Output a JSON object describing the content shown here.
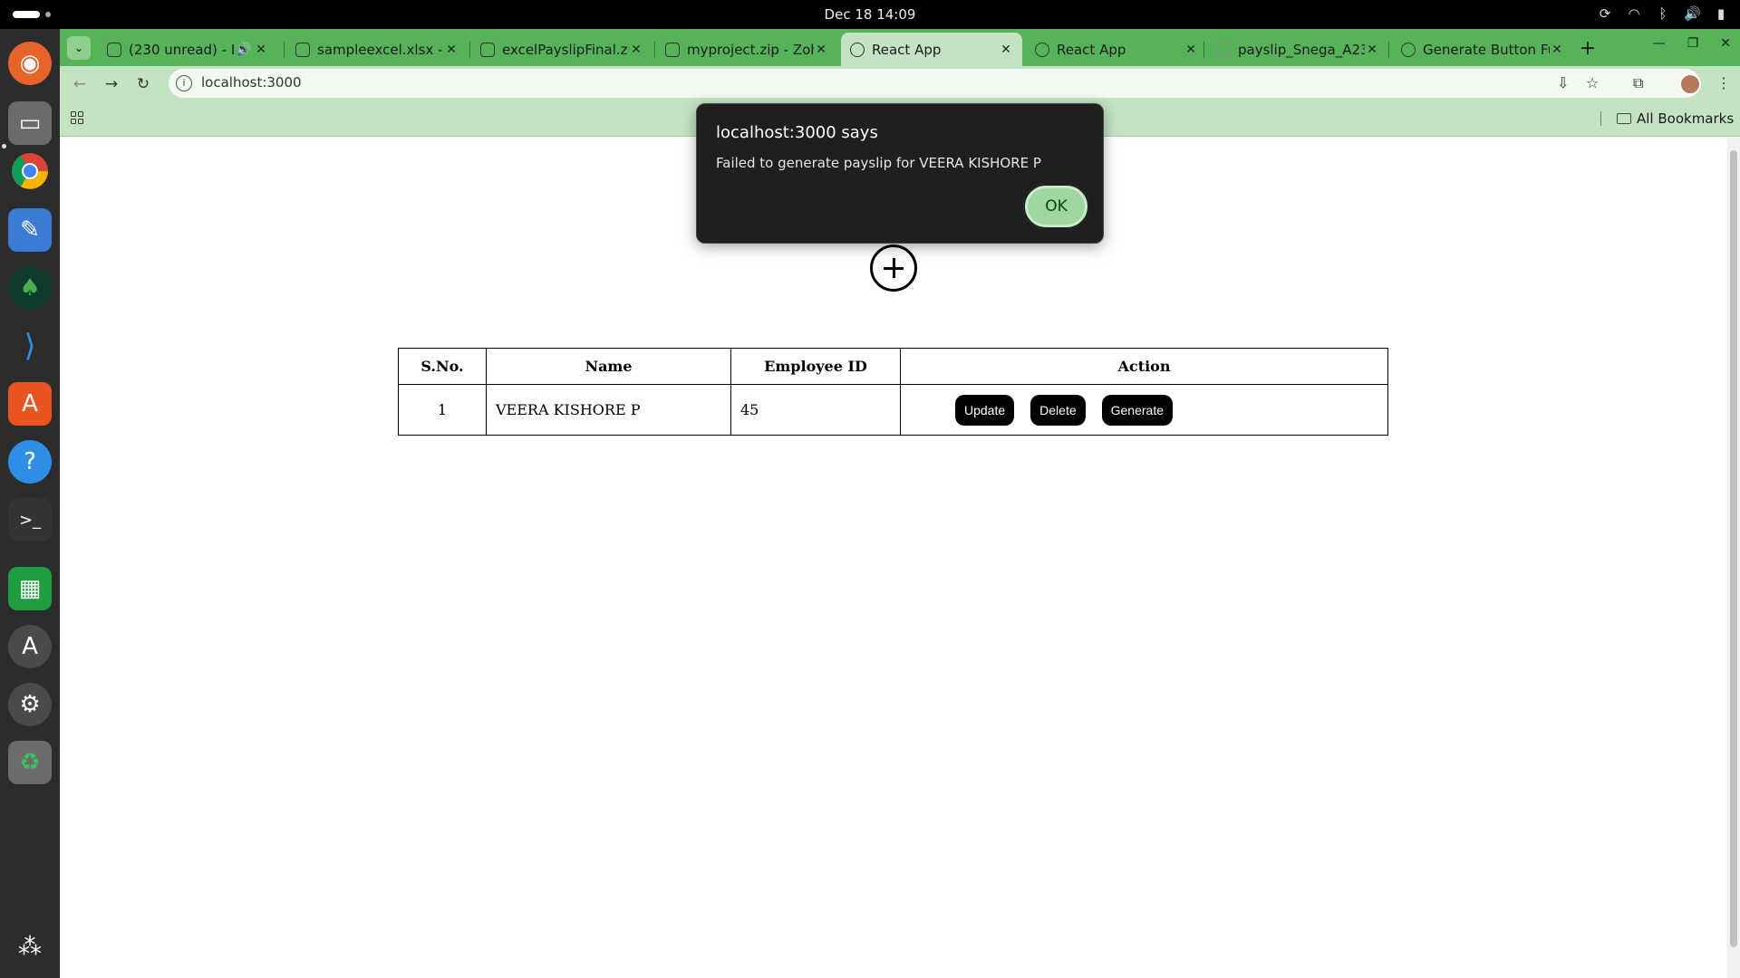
{
  "system": {
    "clock": "Dec 18  14:09"
  },
  "dock": {
    "apps": [
      "firefox-icon",
      "files-icon",
      "chrome-icon",
      "text-editor-icon",
      "mongodb-compass-icon",
      "vscode-icon",
      "app-center-icon",
      "help-icon",
      "terminal-icon",
      "spreadsheet-icon",
      "software-updater-icon",
      "settings-icon",
      "trash-icon",
      "show-apps-icon"
    ]
  },
  "browser": {
    "tabs": [
      {
        "title": "(230 unread) - In",
        "active": false
      },
      {
        "title": "sampleexcel.xlsx - Z",
        "active": false
      },
      {
        "title": "excelPayslipFinal.zip",
        "active": false
      },
      {
        "title": "myproject.zip - Zoho",
        "active": false
      },
      {
        "title": "React App",
        "active": true
      },
      {
        "title": "React App",
        "active": false
      },
      {
        "title": "payslip_Snega_A23",
        "active": false
      },
      {
        "title": "Generate Button Fu",
        "active": false
      }
    ],
    "url": "localhost:3000",
    "bookmarks_label": "All Bookmarks"
  },
  "page": {
    "table": {
      "headers": [
        "S.No.",
        "Name",
        "Employee ID",
        "Action"
      ],
      "rows": [
        {
          "sno": "1",
          "name": "VEERA KISHORE P",
          "emp_id": "45"
        }
      ],
      "actions": {
        "update": "Update",
        "delete": "Delete",
        "generate": "Generate"
      }
    }
  },
  "dialog": {
    "title": "localhost:3000 says",
    "message": "Failed to generate payslip for VEERA KISHORE P",
    "ok_label": "OK"
  }
}
